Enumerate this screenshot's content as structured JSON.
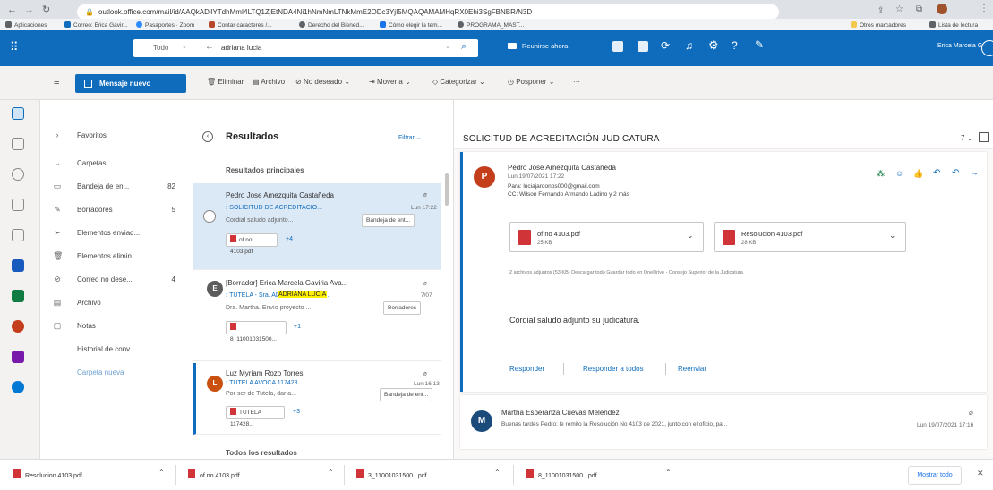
{
  "browser": {
    "url": "outlook.office.com/mail/id/AAQkADllYTdhMmI4LTQ1ZjEtNDA4Ni1hNmNmLTNkMmE2ODc3YjI5MQAQAMAMHqRX0Ehi3SgFBNBR/N3D",
    "bookmarks": [
      "Aplicaciones",
      "Correo: Erica Gavir...",
      "Pasaportes · Zoom",
      "Contar caracteres /...",
      "Derecho del Biened...",
      "Cómo elegir la tem...",
      "PROGRAMA_MAST...",
      "Otros marcadores",
      "Lista de lectura"
    ]
  },
  "header": {
    "scope": "Todo",
    "search_value": "adriana lucia",
    "meet_now": "Reunirse ahora",
    "user_name": "Erica Marcela Gavi..."
  },
  "commands": {
    "new_message": "Mensaje nuevo",
    "delete": "Eliminar",
    "archive": "Archivo",
    "junk": "No deseado",
    "move": "Mover a",
    "categorize": "Categorizar",
    "snooze": "Posponer",
    "more": "···"
  },
  "folders": {
    "favorites": "Favoritos",
    "folders_label": "Carpetas",
    "items": [
      {
        "label": "Bandeja de en...",
        "count": "82",
        "icon": "inbox-icon"
      },
      {
        "label": "Borradores",
        "count": "5",
        "icon": "pencil-icon"
      },
      {
        "label": "Elementos enviad...",
        "count": "",
        "icon": "sent-icon"
      },
      {
        "label": "Elementos elimin...",
        "count": "",
        "icon": "trash-icon"
      },
      {
        "label": "Correo no dese...",
        "count": "4",
        "icon": "block-icon"
      },
      {
        "label": "Archivo",
        "count": "",
        "icon": "archive-icon"
      },
      {
        "label": "Notas",
        "count": "",
        "icon": "note-icon"
      },
      {
        "label": "Historial de conv...",
        "count": "",
        "icon": ""
      },
      {
        "label": "Carpeta nueva",
        "count": "",
        "icon": ""
      }
    ]
  },
  "list": {
    "title": "Resultados",
    "filter": "Filtrar",
    "top_results": "Resultados principales",
    "all_results": "Todos los resultados",
    "messages": [
      {
        "sender": "Pedro Jose Amezquita Castañeda",
        "subject": "SOLICITUD DE ACREDITACIÓ...",
        "time": "Lun 17:22",
        "preview": "Cordial saludo adjunto...",
        "tag": "Bandeja de ent...",
        "attachment": "of no 4103.pdf",
        "extra": "+4",
        "avatar_letter": "P",
        "avatar_color": "#c43e1c"
      },
      {
        "sender": "[Borrador] Erica Marcela Gaviria Ava...",
        "subject": "TUTELA - Sra. ADRIANA LUCÍA F...",
        "highlight": "ADRIANA LUCÍA",
        "time": "7/07",
        "preview": "Dra. Martha. Envío proyecto ...",
        "tag": "Borradores",
        "attachment": "8_11001031500...",
        "extra": "+1",
        "avatar_letter": "E",
        "avatar_color": "#5c5c5c"
      },
      {
        "sender": "Luz Myriam Rozo Torres",
        "subject": "TUTELA AVOCA 117428",
        "time": "Lun 16:13",
        "preview": "Por ser de Tutela, dar a...",
        "tag": "Bandeja de ent...",
        "attachment": "TUTELA 117428...",
        "extra": "+3",
        "avatar_letter": "L",
        "avatar_color": "#ca5010"
      }
    ]
  },
  "reading": {
    "subject": "SOLICITUD DE ACREDITACIÓN JUDICATURA",
    "count": "7",
    "sender": "Pedro Jose Amezquita Castañeda",
    "date": "Lun 19/07/2021 17:22",
    "to": "Para: luciajardonos000@gmail.com",
    "cc": "CC: Wilson Fernando Armando Ladino y 2 más",
    "attachments": [
      {
        "name": "of no 4103.pdf",
        "size": "25 KB"
      },
      {
        "name": "Resolucion 4103.pdf",
        "size": "28 KB"
      }
    ],
    "attach_summary": "2 archivos adjuntos (53 KB)   Descargar todo   Guardar todo en OneDrive - Consejo Superior de la Judicatura",
    "body": "Cordial saludo adjunto su judicatura.",
    "signature": "-----",
    "reply": "Responder",
    "reply_all": "Responder a todos",
    "forward": "Reenviar",
    "second_sender": "Martha Esperanza Cuevas Melendez",
    "second_preview": "Buenas tardes Pedro: le remito la Resolución No 4103 de 2021, junto con el oficio, pa...",
    "second_date": "Lun 19/07/2021 17:16",
    "second_letter": "M"
  },
  "downloads": {
    "items": [
      "Resolucion 4103.pdf",
      "of no 4103.pdf",
      "3_11001031500...pdf",
      "8_11001031500...pdf"
    ],
    "show_all": "Mostrar todo"
  },
  "colors": {
    "brand": "#0f6cbd",
    "highlight": "#fff100",
    "selected": "#dbe8f5"
  }
}
